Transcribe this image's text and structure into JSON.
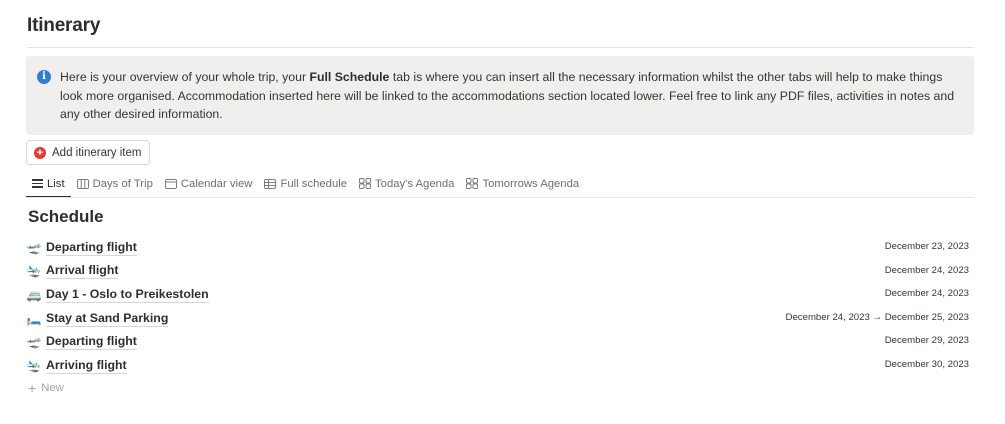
{
  "page": {
    "title": "Itinerary"
  },
  "callout": {
    "icon": "info-icon",
    "text_before": "Here is your overview of your whole trip, your ",
    "text_bold": "Full Schedule",
    "text_after": " tab is where you can insert all the necessary information whilst the other tabs will help to make things look more organised. Accommodation inserted here will be linked to the accommodations section located lower. Feel free to link any PDF files, activities in notes and any other desired information."
  },
  "add_button": {
    "label": "Add itinerary item",
    "icon": "plus-circle-icon"
  },
  "tabs": [
    {
      "label": "List",
      "icon": "list-icon",
      "active": true
    },
    {
      "label": "Days of Trip",
      "icon": "board-icon",
      "active": false
    },
    {
      "label": "Calendar view",
      "icon": "calendar-icon",
      "active": false
    },
    {
      "label": "Full schedule",
      "icon": "table-icon",
      "active": false
    },
    {
      "label": "Today's Agenda",
      "icon": "gallery-icon",
      "active": false
    },
    {
      "label": "Tomorrows Agenda",
      "icon": "gallery-icon",
      "active": false
    }
  ],
  "schedule": {
    "title": "Schedule",
    "items": [
      {
        "emoji": "🛫",
        "icon": "departure-plane-icon",
        "title": "Departing flight",
        "date": "December 23, 2023"
      },
      {
        "emoji": "🛬",
        "icon": "arrival-plane-icon",
        "title": "Arrival flight",
        "date": "December 24, 2023"
      },
      {
        "emoji": "🚐",
        "icon": "van-icon",
        "title": "Day 1 - Oslo to Preikestolen",
        "date": "December 24, 2023"
      },
      {
        "emoji": "🛏️",
        "icon": "bed-icon",
        "title": "Stay at Sand Parking",
        "date": "December 24, 2023 → December 25, 2023"
      },
      {
        "emoji": "🛫",
        "icon": "departure-plane-icon",
        "title": "Departing flight",
        "date": "December 29, 2023"
      },
      {
        "emoji": "🛬",
        "icon": "arrival-plane-icon",
        "title": "Arriving flight",
        "date": "December 30, 2023"
      }
    ],
    "new_label": "New"
  },
  "colors": {
    "callout_bg": "#f1efed",
    "info_blue": "#2f7fd1",
    "add_red": "#dd3d35",
    "text": "#37352f"
  }
}
